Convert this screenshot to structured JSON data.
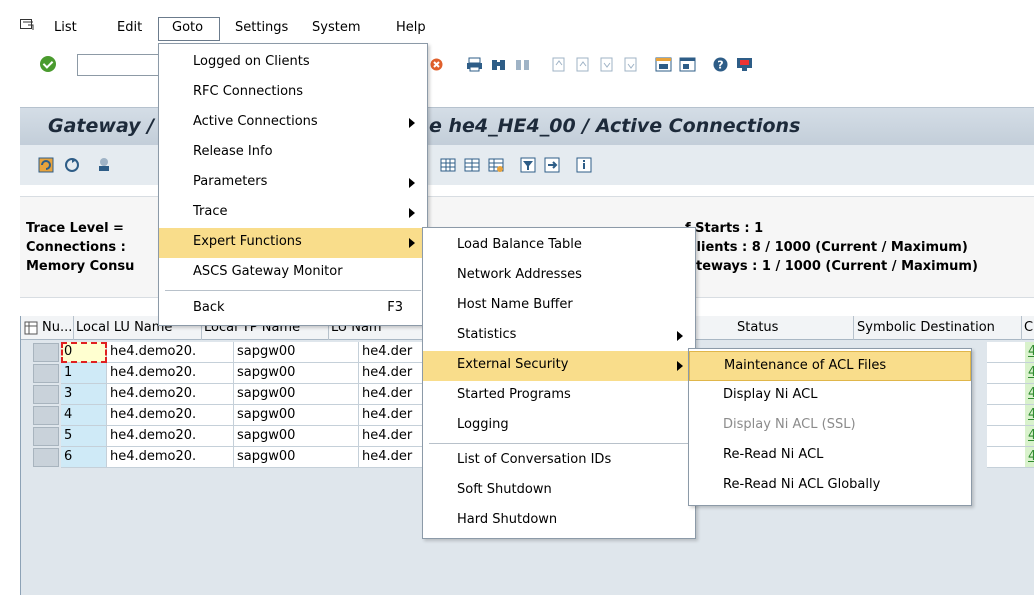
{
  "menubar": {
    "items": [
      {
        "label": "List"
      },
      {
        "label": "Edit"
      },
      {
        "label": "Goto"
      },
      {
        "label": "Settings"
      },
      {
        "label": "System"
      },
      {
        "label": "Help"
      }
    ]
  },
  "title": {
    "left": "Gateway /",
    "right": "e he4_HE4_00 / Active Connections"
  },
  "info": {
    "trace_level": "Trace Level =",
    "connections": "Connections :",
    "memory": "Memory Consu",
    "starts": "f Starts : 1",
    "clients": "Clients : 8 / 1000 (Current / Maximum)",
    "gateways": "teways : 1 / 1000 (Current / Maximum)"
  },
  "grid": {
    "columns": [
      "Nu...",
      "Local LU Name",
      "Local TP Name",
      "LU Nam",
      "Status",
      "Symbolic Destination",
      "C"
    ],
    "rows": [
      {
        "num": "0",
        "lu": "he4.demo20.",
        "tp": "sapgw00",
        "lunam": "he4.der",
        "link": "4"
      },
      {
        "num": "1",
        "lu": "he4.demo20.",
        "tp": "sapgw00",
        "lunam": "he4.der",
        "link": "4"
      },
      {
        "num": "3",
        "lu": "he4.demo20.",
        "tp": "sapgw00",
        "lunam": "he4.der",
        "link": "4"
      },
      {
        "num": "4",
        "lu": "he4.demo20.",
        "tp": "sapgw00",
        "lunam": "he4.der",
        "link": "4"
      },
      {
        "num": "5",
        "lu": "he4.demo20.",
        "tp": "sapgw00",
        "lunam": "he4.der",
        "link": "4"
      },
      {
        "num": "6",
        "lu": "he4.demo20.",
        "tp": "sapgw00",
        "lunam": "he4.der",
        "link": "4"
      }
    ]
  },
  "goto_menu": {
    "items": [
      {
        "label": "Logged on Clients"
      },
      {
        "label": "RFC Connections"
      },
      {
        "label": "Active Connections"
      },
      {
        "label": "Release Info"
      },
      {
        "label": "Parameters"
      },
      {
        "label": "Trace"
      },
      {
        "label": "Expert Functions"
      },
      {
        "label": "ASCS Gateway Monitor"
      },
      {
        "label": "Back",
        "shortcut": "F3"
      }
    ]
  },
  "expert_menu": {
    "items": [
      {
        "label": "Load Balance Table"
      },
      {
        "label": "Network Addresses"
      },
      {
        "label": "Host Name Buffer"
      },
      {
        "label": "Statistics"
      },
      {
        "label": "External Security"
      },
      {
        "label": "Started Programs"
      },
      {
        "label": "Logging"
      },
      {
        "label": "List of Conversation IDs"
      },
      {
        "label": "Soft Shutdown"
      },
      {
        "label": "Hard Shutdown"
      }
    ]
  },
  "security_menu": {
    "items": [
      {
        "label": "Maintenance of ACL Files"
      },
      {
        "label": "Display Ni ACL"
      },
      {
        "label": "Display Ni ACL (SSL)"
      },
      {
        "label": "Re-Read Ni ACL"
      },
      {
        "label": "Re-Read Ni ACL Globally"
      }
    ]
  },
  "colors": {
    "highlight": "#f9dd8b",
    "key_cell": "#cfeaf7",
    "title_bg": "#c9d4de"
  }
}
